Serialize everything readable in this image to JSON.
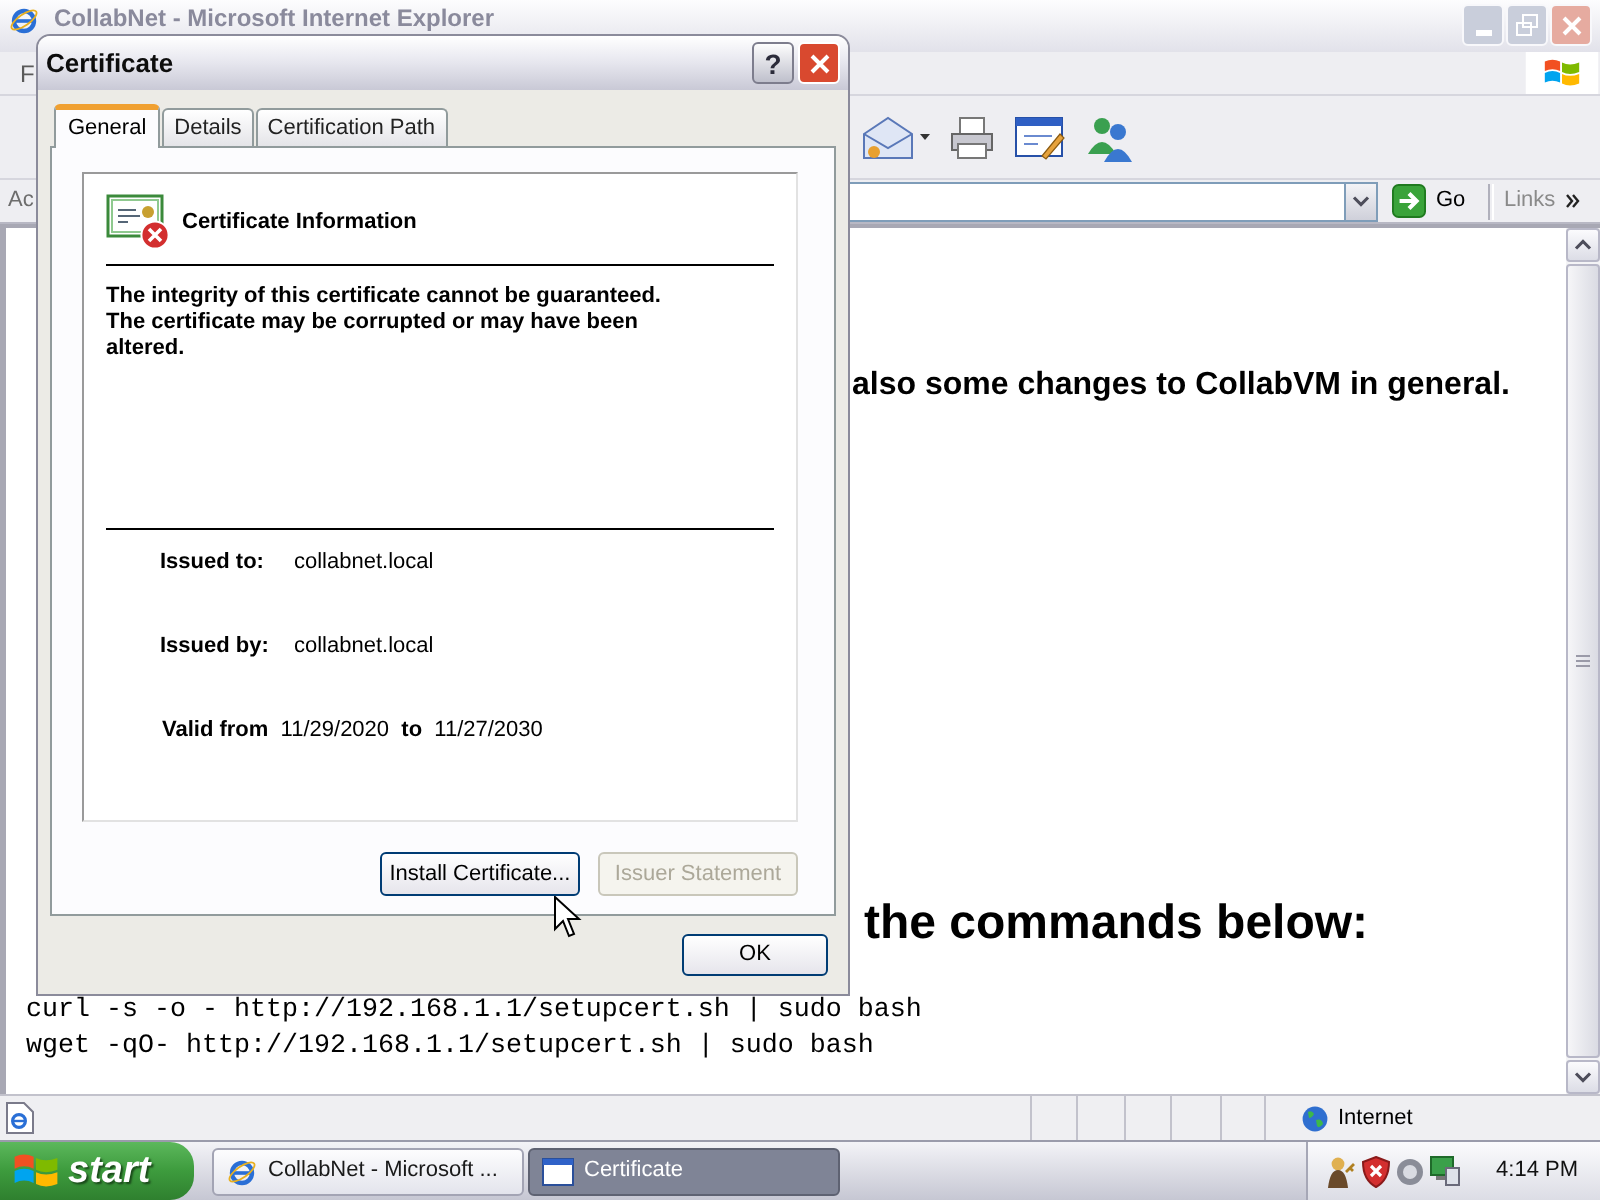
{
  "browser_window": {
    "title": "CollabNet - Microsoft Internet Explorer",
    "active": false,
    "menu_items": [
      "F"
    ],
    "address_bar": {
      "label": "Ac",
      "go_button": "Go",
      "links": "Links"
    },
    "page": {
      "paragraph_end": "also some changes to CollabVM in general.",
      "heading_end": "the commands below:",
      "code_lines": [
        "curl -s -o - http://192.168.1.1/setupcert.sh | sudo bash",
        "wget -qO- http://192.168.1.1/setupcert.sh | sudo bash"
      ]
    },
    "status_bar": {
      "zone": "Internet"
    }
  },
  "dialog": {
    "title": "Certificate",
    "help_button": "?",
    "tabs": [
      {
        "label": "General",
        "selected": true
      },
      {
        "label": "Details",
        "selected": false
      },
      {
        "label": "Certification Path",
        "selected": false
      }
    ],
    "heading": "Certificate Information",
    "message": "The integrity of this certificate cannot be guaranteed. The certificate may be corrupted or may have been altered.",
    "fields": [
      {
        "label": "Issued to:",
        "value": "collabnet.local"
      },
      {
        "label": "Issued by:",
        "value": "collabnet.local"
      }
    ],
    "validity": "**Valid from**  11/29/2020  **to**  11/27/2030",
    "buttons": [
      {
        "label": "Install Certificate...",
        "disabled": false
      },
      {
        "label": "Issuer Statement",
        "disabled": true
      }
    ],
    "ok_button": "OK"
  },
  "taskbar": {
    "start_button": "start",
    "tasks": [
      {
        "label": "CollabNet - Microsoft ...",
        "kind": "browser",
        "selected": false
      },
      {
        "label": "Certificate",
        "kind": "window",
        "selected": true
      }
    ],
    "clock": "4:14 PM"
  }
}
